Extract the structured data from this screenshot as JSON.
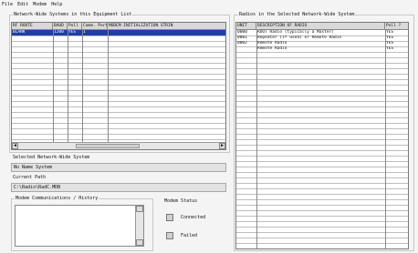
{
  "menu": {
    "items": [
      {
        "label": "File"
      },
      {
        "label": "Edit"
      },
      {
        "label": "Modem"
      },
      {
        "label": "Help"
      }
    ]
  },
  "systems_panel": {
    "title": "Network-Wide Systems in this Equipment List",
    "columns": [
      "RF ROUTE",
      "BAUD",
      "Poll ?",
      "Comm. Port",
      "MODEM INITIALIZATION STRIN"
    ],
    "rows": [
      {
        "route": "BLANK",
        "baud": "1200",
        "poll": "YES",
        "port": "1",
        "init": ""
      }
    ]
  },
  "radios_panel": {
    "title": "Radios in the Selected Network-Wide System",
    "columns": [
      "UNIT",
      "DESCRIPTION OF RADIO",
      "Poll ?"
    ],
    "rows": [
      {
        "unit": "0000",
        "desc": "ROOT Radio (typically a Master)",
        "poll": "YES"
      },
      {
        "unit": "0001",
        "desc": "Repeater (if used) or Remote Radio",
        "poll": "YES"
      },
      {
        "unit": "0002",
        "desc": "Remote Radio",
        "poll": "YES"
      },
      {
        "unit": "",
        "desc": "Remote Radio",
        "poll": "YES"
      }
    ]
  },
  "selected_system": {
    "label": "Selected Network-Wide System",
    "value": "No Name System"
  },
  "current_path": {
    "label": "Current Path",
    "value": "C:\\Radio\\RadC.MDB"
  },
  "modem_comm": {
    "label": "Modem Communications / History"
  },
  "modem_status": {
    "label": "Modem Status",
    "connected": "Connected",
    "failed": "Failed"
  }
}
